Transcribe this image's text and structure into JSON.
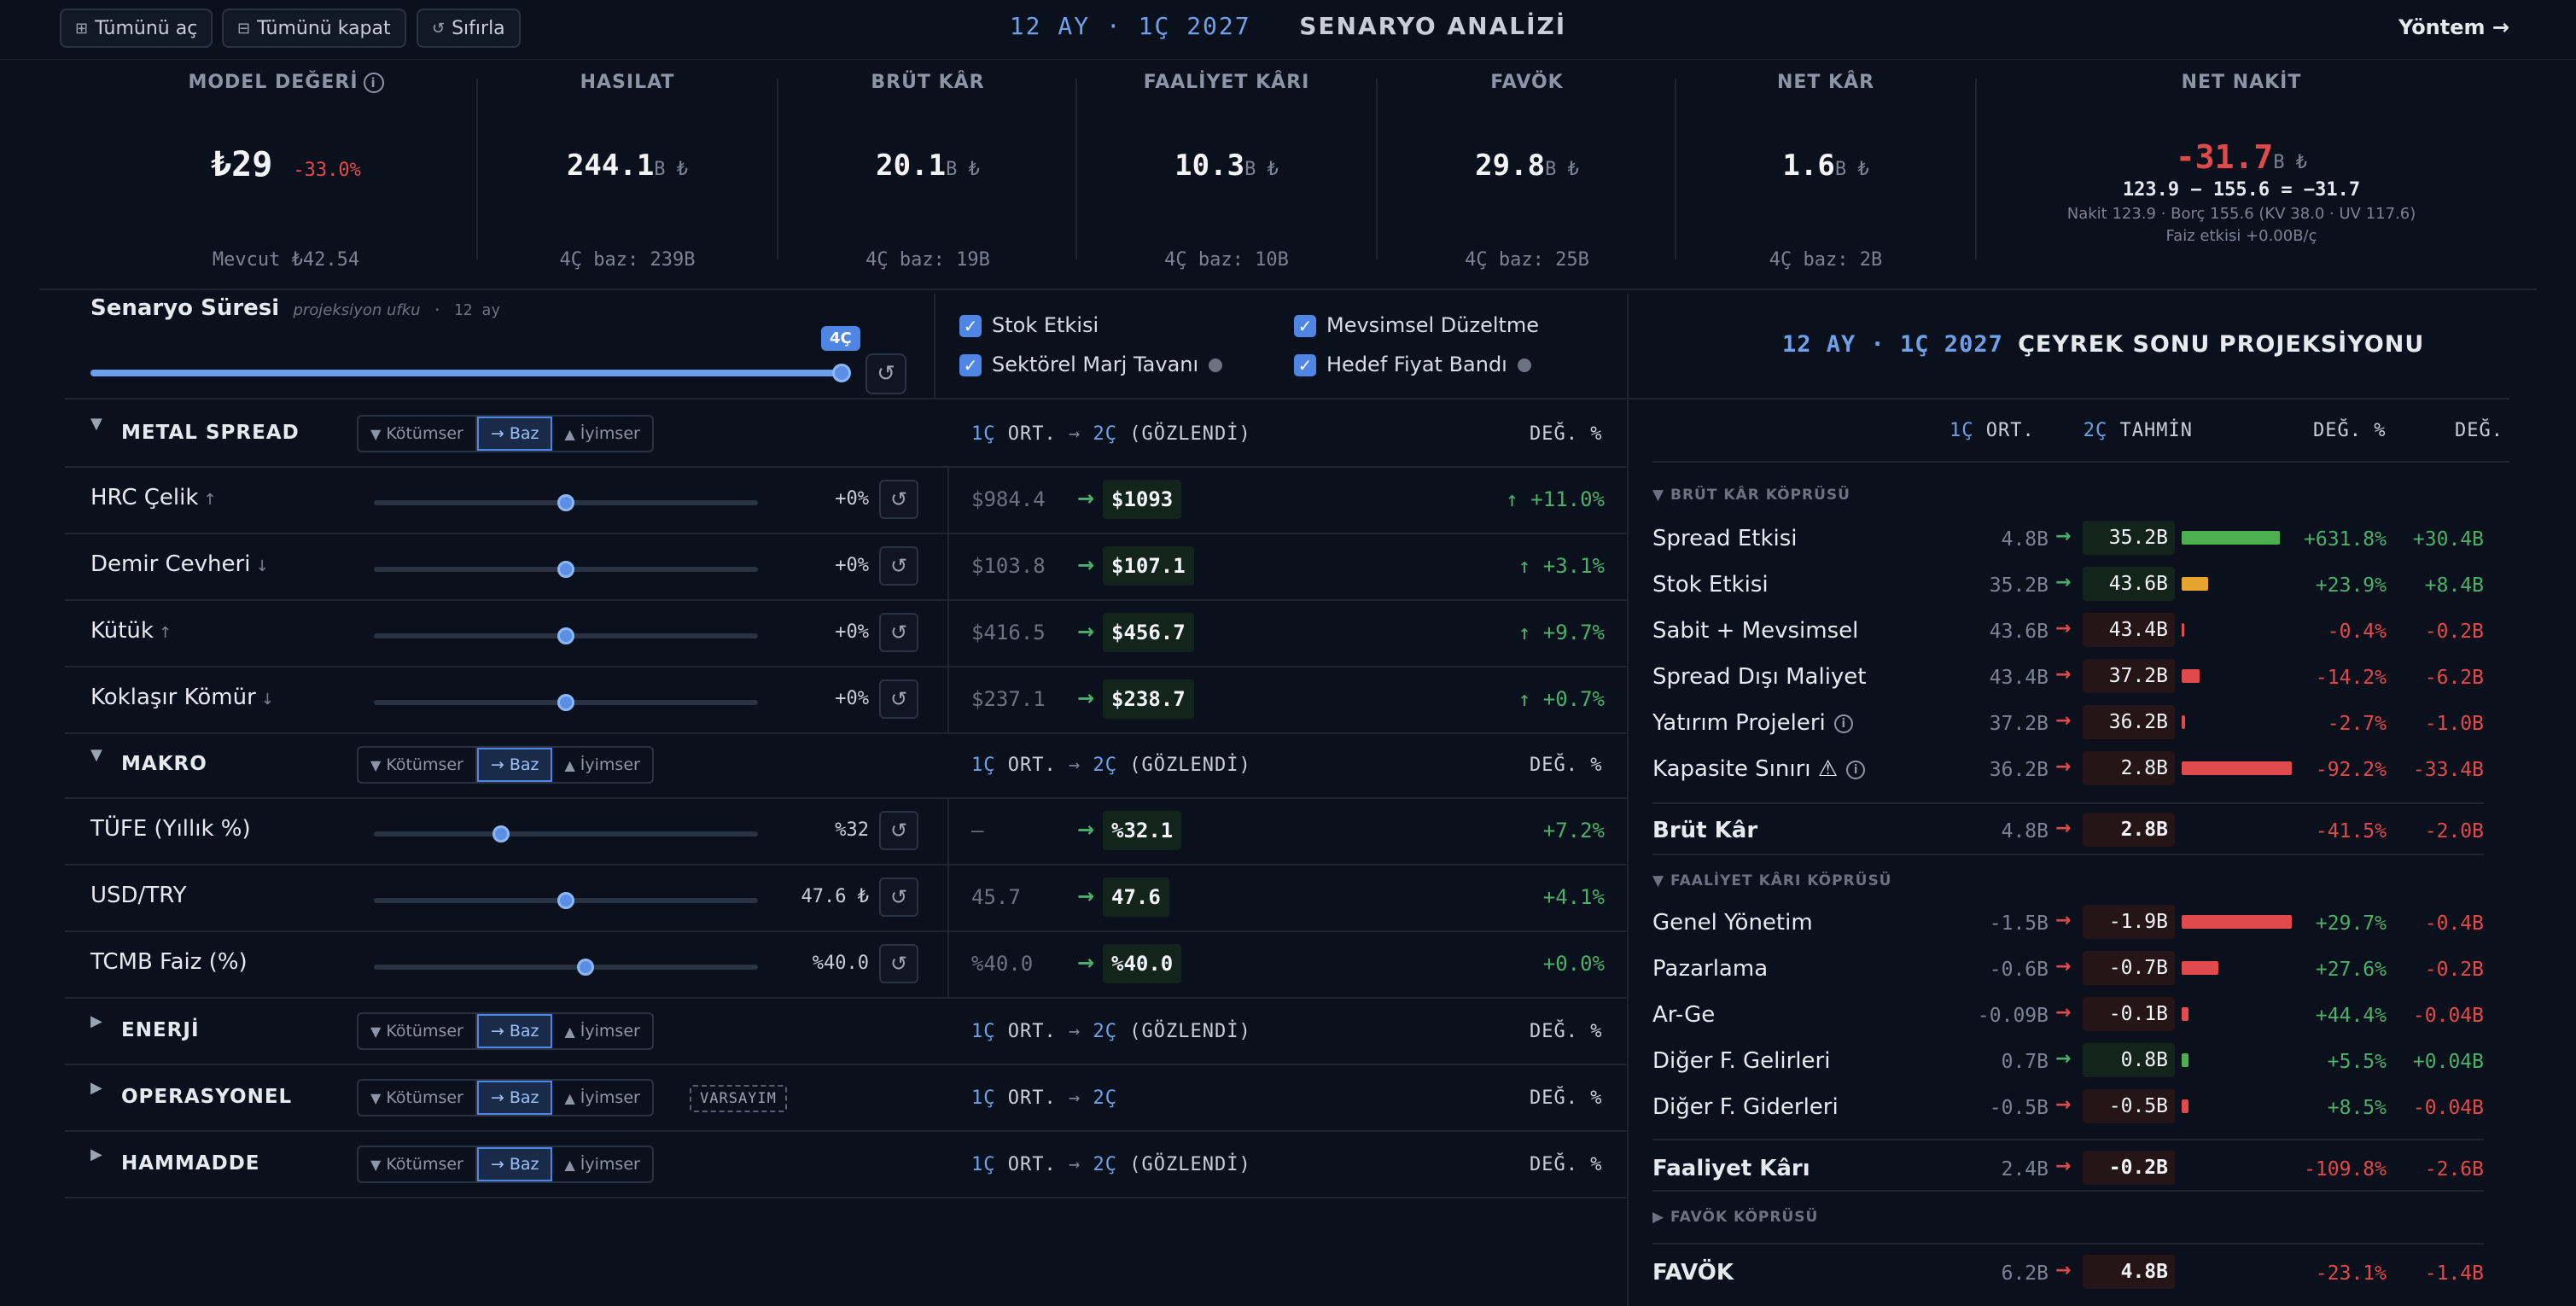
{
  "toolbar": {
    "expand_all": "Tümünü aç",
    "collapse_all": "Tümünü kapat",
    "reset": "Sıfırla",
    "title_period": "12 AY · 1Ç 2027",
    "title_text": "SENARYO ANALİZİ",
    "method": "Yöntem →"
  },
  "kpis": {
    "model": {
      "label": "MODEL DEĞERİ",
      "value": "₺29",
      "change": "-33.0%",
      "foot": "Mevcut ₺42.54"
    },
    "revenue": {
      "label": "HASILAT",
      "value": "244.1",
      "unit": "B ₺",
      "foot": "4Ç baz: 239B"
    },
    "gross": {
      "label": "BRÜT KÂR",
      "value": "20.1",
      "unit": "B ₺",
      "foot": "4Ç baz: 19B"
    },
    "operating": {
      "label": "FAALİYET KÂRI",
      "value": "10.3",
      "unit": "B ₺",
      "foot": "4Ç baz: 10B"
    },
    "ebitda": {
      "label": "FAVÖK",
      "value": "29.8",
      "unit": "B ₺",
      "foot": "4Ç baz: 25B"
    },
    "net": {
      "label": "NET KÂR",
      "value": "1.6",
      "unit": "B ₺",
      "foot": "4Ç baz: 2B"
    },
    "netcash": {
      "label": "NET NAKİT",
      "value": "-31.7",
      "unit": "B ₺",
      "formula": "123.9 − 155.6 = −31.7",
      "detail": "Nakit 123.9 · Borç 155.6 (KV 38.0 · UV 117.6)",
      "interest": "Faiz etkisi +0.00B/ç"
    }
  },
  "scenario": {
    "title": "Senaryo Süresi",
    "hint": "projeksiyon ufku",
    "sep": "·",
    "horizon": "12 ay",
    "bubble": "4Ç",
    "level": 1.0,
    "checks": {
      "stock": "Stok Etkisi",
      "seasonal": "Mevsimsel Düzeltme",
      "sector_cap": "Sektörel Marj Tavanı",
      "target_band": "Hedef Fiyat Bandı"
    }
  },
  "seg": {
    "bad": "Kötümser",
    "base": "→ Baz",
    "good": "İyimser"
  },
  "cols": {
    "q1": "1Ç",
    "avg": "ORT.",
    "arrow": "→",
    "q2": "2Ç",
    "observed": "(GÖZLENDİ)",
    "chg": "DEĞ. %"
  },
  "sections": {
    "metal": {
      "title": "METAL SPREAD",
      "rows": [
        {
          "label": "HRC Çelik",
          "dir": "↑",
          "pos": 0.5,
          "pct": "+0%",
          "prev": "$984.4",
          "new": "$1093",
          "chg": "↑ +11.0%"
        },
        {
          "label": "Demir Cevheri",
          "dir": "↓",
          "pos": 0.5,
          "pct": "+0%",
          "prev": "$103.8",
          "new": "$107.1",
          "chg": "↑ +3.1%"
        },
        {
          "label": "Kütük",
          "dir": "↑",
          "pos": 0.5,
          "pct": "+0%",
          "prev": "$416.5",
          "new": "$456.7",
          "chg": "↑ +9.7%"
        },
        {
          "label": "Koklaşır Kömür",
          "dir": "↓",
          "pos": 0.5,
          "pct": "+0%",
          "prev": "$237.1",
          "new": "$238.7",
          "chg": "↑ +0.7%"
        }
      ]
    },
    "macro": {
      "title": "MAKRO",
      "rows": [
        {
          "label": "TÜFE (Yıllık %)",
          "dir": "",
          "pos": 0.33,
          "pct": "%32",
          "prev": "—",
          "new": "%32.1",
          "chg": "+7.2%"
        },
        {
          "label": "USD/TRY",
          "dir": "",
          "pos": 0.5,
          "pct": "47.6 ₺",
          "prev": "45.7",
          "new": "47.6",
          "chg": "+4.1%"
        },
        {
          "label": "TCMB Faiz (%)",
          "dir": "",
          "pos": 0.55,
          "pct": "%40.0",
          "prev": "%40.0",
          "new": "%40.0",
          "chg": "+0.0%"
        }
      ]
    },
    "energy": {
      "title": "ENERJİ"
    },
    "ops": {
      "title": "OPERASYONEL",
      "badge": "VARSAYIM"
    },
    "raw": {
      "title": "HAMMADDE"
    }
  },
  "right": {
    "title_period": "12 AY · 1Ç 2027",
    "title_text": "ÇEYREK SONU PROJEKSİYONU",
    "h_q1": "1Ç",
    "h_avg": "ORT.",
    "h_q2": "2Ç",
    "h_est": "TAHMİN",
    "h_pct": "DEĞ. %",
    "h_chg": "DEĞ.",
    "gross_bridge": "▼ BRÜT KÂR KÖPRÜSÜ",
    "op_bridge": "▼ FAALİYET KÂRI KÖPRÜSÜ",
    "ebitda_bridge": "▶ FAVÖK KÖPRÜSÜ",
    "gross_rows": [
      {
        "label": "Spread Etkisi",
        "prev": "4.8B",
        "new": "35.2B",
        "bar": 0.82,
        "color": "#4caf50",
        "pct": "+631.8%",
        "delta": "+30.4B",
        "up": true
      },
      {
        "label": "Stok Etkisi",
        "prev": "35.2B",
        "new": "43.6B",
        "bar": 0.22,
        "color": "#e6a32e",
        "pct": "+23.9%",
        "delta": "+8.4B",
        "up": true
      },
      {
        "label": "Sabit + Mevsimsel",
        "prev": "43.6B",
        "new": "43.4B",
        "bar": 0.01,
        "color": "#e04a4a",
        "pct": "-0.4%",
        "delta": "-0.2B",
        "up": false
      },
      {
        "label": "Spread Dışı Maliyet",
        "prev": "43.4B",
        "new": "37.2B",
        "bar": 0.15,
        "color": "#e04a4a",
        "pct": "-14.2%",
        "delta": "-6.2B",
        "up": false
      },
      {
        "label": "Yatırım Projeleri",
        "prev": "37.2B",
        "new": "36.2B",
        "bar": 0.03,
        "color": "#e04a4a",
        "pct": "-2.7%",
        "delta": "-1.0B",
        "up": false,
        "info": true
      },
      {
        "label": "Kapasite Sınırı ⚠",
        "prev": "36.2B",
        "new": "2.8B",
        "bar": 0.92,
        "color": "#e04a4a",
        "pct": "-92.2%",
        "delta": "-33.4B",
        "up": false,
        "info": true
      }
    ],
    "gross_total": {
      "label": "Brüt Kâr",
      "prev": "4.8B",
      "new": "2.8B",
      "pct": "-41.5%",
      "delta": "-2.0B"
    },
    "op_rows": [
      {
        "label": "Genel Yönetim",
        "prev": "-1.5B",
        "new": "-1.9B",
        "bar": 0.92,
        "color": "#e04a4a",
        "pct": "+29.7%",
        "delta": "-0.4B",
        "up": false
      },
      {
        "label": "Pazarlama",
        "prev": "-0.6B",
        "new": "-0.7B",
        "bar": 0.31,
        "color": "#e04a4a",
        "pct": "+27.6%",
        "delta": "-0.2B",
        "up": false
      },
      {
        "label": "Ar-Ge",
        "prev": "-0.09B",
        "new": "-0.1B",
        "bar": 0.06,
        "color": "#e04a4a",
        "pct": "+44.4%",
        "delta": "-0.04B",
        "up": false
      },
      {
        "label": "Diğer F. Gelirleri",
        "prev": "0.7B",
        "new": "0.8B",
        "bar": 0.06,
        "color": "#4caf50",
        "pct": "+5.5%",
        "delta": "+0.04B",
        "up": true
      },
      {
        "label": "Diğer F. Giderleri",
        "prev": "-0.5B",
        "new": "-0.5B",
        "bar": 0.06,
        "color": "#e04a4a",
        "pct": "+8.5%",
        "delta": "-0.04B",
        "up": false
      }
    ],
    "op_total": {
      "label": "Faaliyet Kârı",
      "prev": "2.4B",
      "new": "-0.2B",
      "pct": "-109.8%",
      "delta": "-2.6B"
    },
    "ebitda_total": {
      "label": "FAVÖK",
      "prev": "6.2B",
      "new": "4.8B",
      "pct": "-23.1%",
      "delta": "-1.4B"
    }
  }
}
